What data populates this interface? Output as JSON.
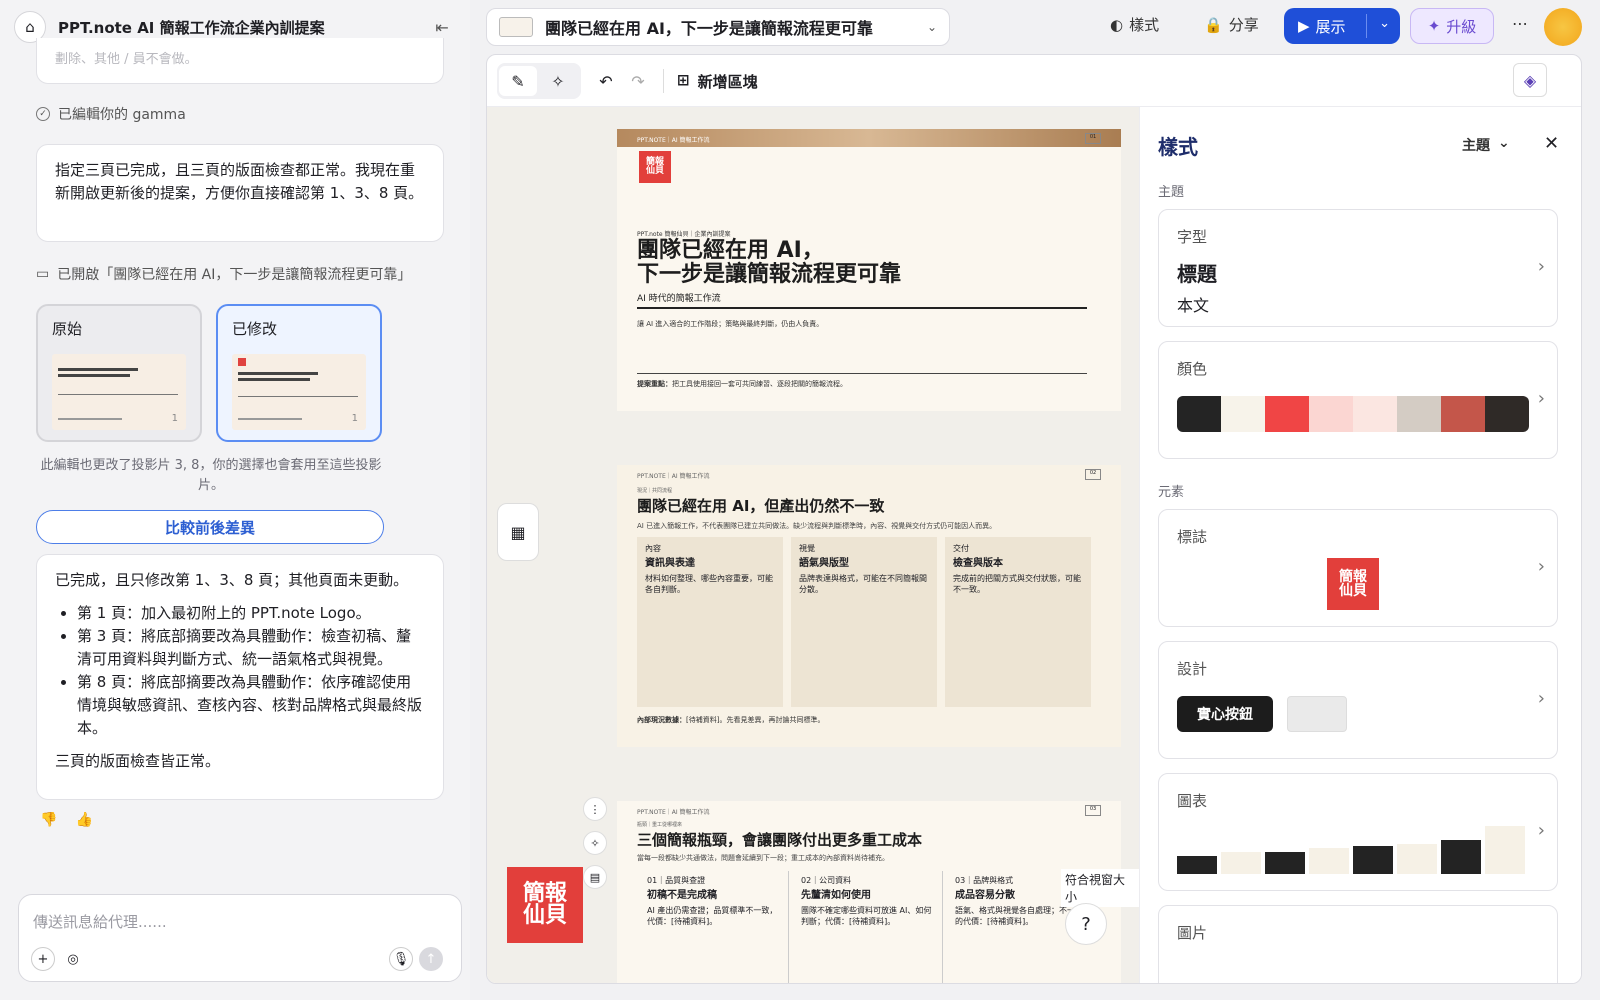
{
  "left_panel": {
    "title": "PPT.note AI 簡報工作流企業內訓提案",
    "truncated_text": "劃除、其他 / 員不會做。",
    "status": "已編輯你的 gamma",
    "msg1": "指定三頁已完成，且三頁的版面檢查都正常。我現在重新開啟更新後的提案，方便你直接確認第 1、3、8 頁。",
    "open_line": "已開啟「團隊已經在用 AI，下一步是讓簡報流程更可靠」",
    "versions": [
      {
        "label": "原始",
        "slide_num": "1"
      },
      {
        "label": "已修改",
        "slide_num": "1"
      }
    ],
    "note": "此編輯也更改了投影片 3, 8，你的選擇也會套用至這些投影片。",
    "compare_button": "比較前後差異",
    "msg2": {
      "intro": "已完成，且只修改第 1、3、8 頁；其他頁面未更動。",
      "items": [
        "第 1 頁：加入最初附上的 PPT.note Logo。",
        "第 3 頁：將底部摘要改為具體動作：檢查初稿、釐清可用資料與判斷方式、統一語氣格式與視覺。",
        "第 8 頁：將底部摘要改為具體動作：依序確認使用情境與敏感資訊、查核內容、核對品牌格式與最終版本。"
      ],
      "outro": "三頁的版面檢查皆正常。"
    },
    "input_placeholder": "傳送訊息給代理......"
  },
  "topbar": {
    "slide_title": "團隊已經在用 AI，下一步是讓簡報流程更可靠",
    "style_label": "樣式",
    "share_label": "分享",
    "present_label": "展示",
    "upgrade_label": "升級"
  },
  "toolbar": {
    "add_block_label": "新增區塊"
  },
  "slides": [
    {
      "header": "PPT.NOTE｜AI 簡報工作流",
      "page": "01",
      "kicker": "PPT.note 簡報仙貝｜企業內訓提案",
      "title_line1": "團隊已經在用 AI，",
      "title_line2": "下一步是讓簡報流程更可靠",
      "subtitle": "AI 時代的簡報工作流",
      "desc": "讓 AI 進入適合的工作階段；策略與最終判斷，仍由人負責。",
      "foot_label": "提案重點：",
      "foot": "把工具使用接回一套可共同練習、逐段把關的簡報流程。"
    },
    {
      "header": "PPT.NOTE｜AI 簡報工作流",
      "page": "02",
      "kicker": "現況｜共同流程",
      "title": "團隊已經在用 AI，但產出仍然不一致",
      "desc": "AI 已進入簡報工作，不代表團隊已建立共同做法。缺少流程與判斷標準時，內容、視覺與交付方式仍可能因人而異。",
      "cols": [
        {
          "tag": "內容",
          "title": "資訊與表達",
          "body": "材料如何整理、哪些內容重要，可能各自判斷。"
        },
        {
          "tag": "視覺",
          "title": "語氣與版型",
          "body": "品牌表達與格式，可能在不同簡報間分散。"
        },
        {
          "tag": "交付",
          "title": "檢查與版本",
          "body": "完成前的把關方式與交付狀態，可能不一致。"
        }
      ],
      "foot_label": "內部現況數據：",
      "foot": "[待補資料]。先看見差異，再討論共同標準。"
    },
    {
      "header": "PPT.NOTE｜AI 簡報工作流",
      "page": "03",
      "kicker": "瓶頸｜重工從哪裡來",
      "title": "三個簡報瓶頸，會讓團隊付出更多重工成本",
      "desc": "當每一段都缺少共通做法，問題會延續到下一段；重工成本的內部資料尚待補充。",
      "cols": [
        {
          "tag": "01｜品質與查證",
          "title": "初稿不是完成稿",
          "body": "AI 產出仍需查證；品質標準不一致，代價：[待補資料]。"
        },
        {
          "tag": "02｜公司資料",
          "title": "先釐清如何使用",
          "body": "團隊不確定哪些資料可放進 AI、如何判斷；代價：[待補資料]。"
        },
        {
          "tag": "03｜品牌與格式",
          "title": "成品容易分散",
          "body": "語氣、格式與視覺各自處理；不一致的代價：[待補資料]。"
        }
      ]
    }
  ],
  "logo_text": {
    "top": "簡報",
    "bottom": "仙貝"
  },
  "fit_label": "符合視窗大小",
  "help_label": "?",
  "style_panel": {
    "title": "樣式",
    "theme_dropdown": "主題",
    "section_theme": "主題",
    "font_label": "字型",
    "font_heading": "標題",
    "font_body": "本文",
    "color_label": "顏色",
    "colors": [
      "#242424",
      "#f7f3ea",
      "#f04545",
      "#fbd6d2",
      "#fbe6e1",
      "#d4ccc4",
      "#c4564a",
      "#2f2a27"
    ],
    "section_elements": "元素",
    "logo_label": "標誌",
    "design_label": "設計",
    "solid_button_label": "實心按鈕",
    "chart_label": "圖表",
    "image_label": "圖片"
  }
}
